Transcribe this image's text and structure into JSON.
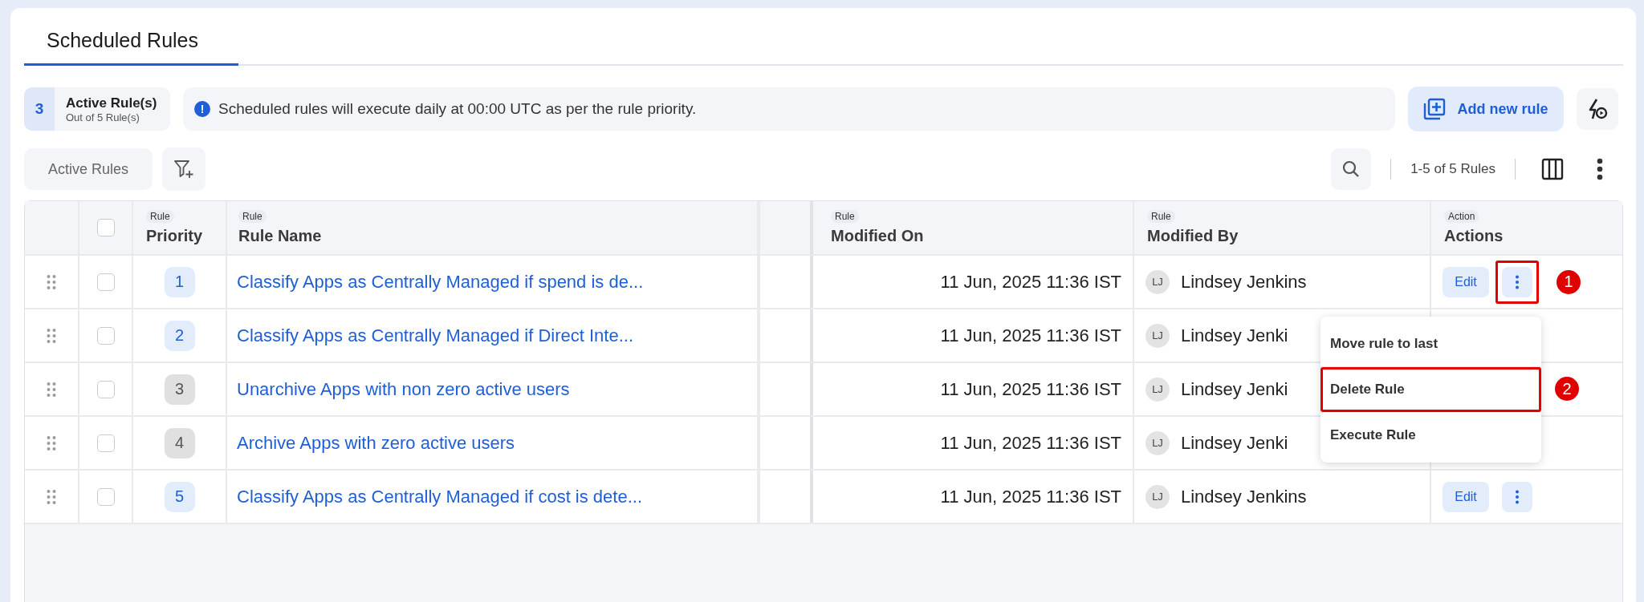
{
  "tabs": [
    {
      "label": "Scheduled Rules",
      "selected": true
    }
  ],
  "summary": {
    "count": "3",
    "title": "Active Rule(s)",
    "subtitle": "Out of 5 Rule(s)"
  },
  "info_banner": {
    "icon": "!",
    "text": "Scheduled rules will execute daily at 00:00 UTC as per the rule priority."
  },
  "add_button": {
    "label": "Add new rule"
  },
  "filter_chip": {
    "label": "Active Rules"
  },
  "pagination": {
    "text": "1-5 of 5 Rules"
  },
  "table": {
    "select_all": {
      "checked": false
    },
    "columns": [
      {
        "tag": "Rule",
        "label": "Priority"
      },
      {
        "tag": "Rule",
        "label": "Rule Name"
      },
      {
        "tag": "Rule",
        "label": "Modified On"
      },
      {
        "tag": "Rule",
        "label": "Modified By"
      },
      {
        "tag": "Action",
        "label": "Actions"
      }
    ],
    "rows": [
      {
        "checked": false,
        "priority": "1",
        "active": true,
        "name": "Classify Apps as Centrally Managed if spend is de...",
        "modified_on": "11 Jun, 2025 11:36 IST",
        "initials": "LJ",
        "modified_by": "Lindsey Jenkins",
        "edit": "Edit",
        "menu_highlighted": true,
        "callout": "1"
      },
      {
        "checked": false,
        "priority": "2",
        "active": true,
        "name": "Classify Apps as Centrally Managed if Direct Inte...",
        "modified_on": "11 Jun, 2025 11:36 IST",
        "initials": "LJ",
        "modified_by": "Lindsey Jenki"
      },
      {
        "checked": false,
        "priority": "3",
        "active": false,
        "name": "Unarchive Apps with non zero active users",
        "modified_on": "11 Jun, 2025 11:36 IST",
        "initials": "LJ",
        "modified_by": "Lindsey Jenki"
      },
      {
        "checked": false,
        "priority": "4",
        "active": false,
        "name": "Archive Apps with zero active users",
        "modified_on": "11 Jun, 2025 11:36 IST",
        "initials": "LJ",
        "modified_by": "Lindsey Jenki"
      },
      {
        "checked": false,
        "priority": "5",
        "active": true,
        "name": "Classify Apps as Centrally Managed if cost is dete...",
        "modified_on": "11 Jun, 2025 11:36 IST",
        "initials": "LJ",
        "modified_by": "Lindsey Jenkins",
        "edit": "Edit",
        "menu_highlighted": false
      }
    ]
  },
  "row_menu": {
    "items": [
      {
        "label": "Move rule to last",
        "highlighted": false
      },
      {
        "label": "Delete Rule",
        "highlighted": true,
        "callout": "2"
      },
      {
        "label": "Execute Rule",
        "highlighted": false
      }
    ]
  }
}
